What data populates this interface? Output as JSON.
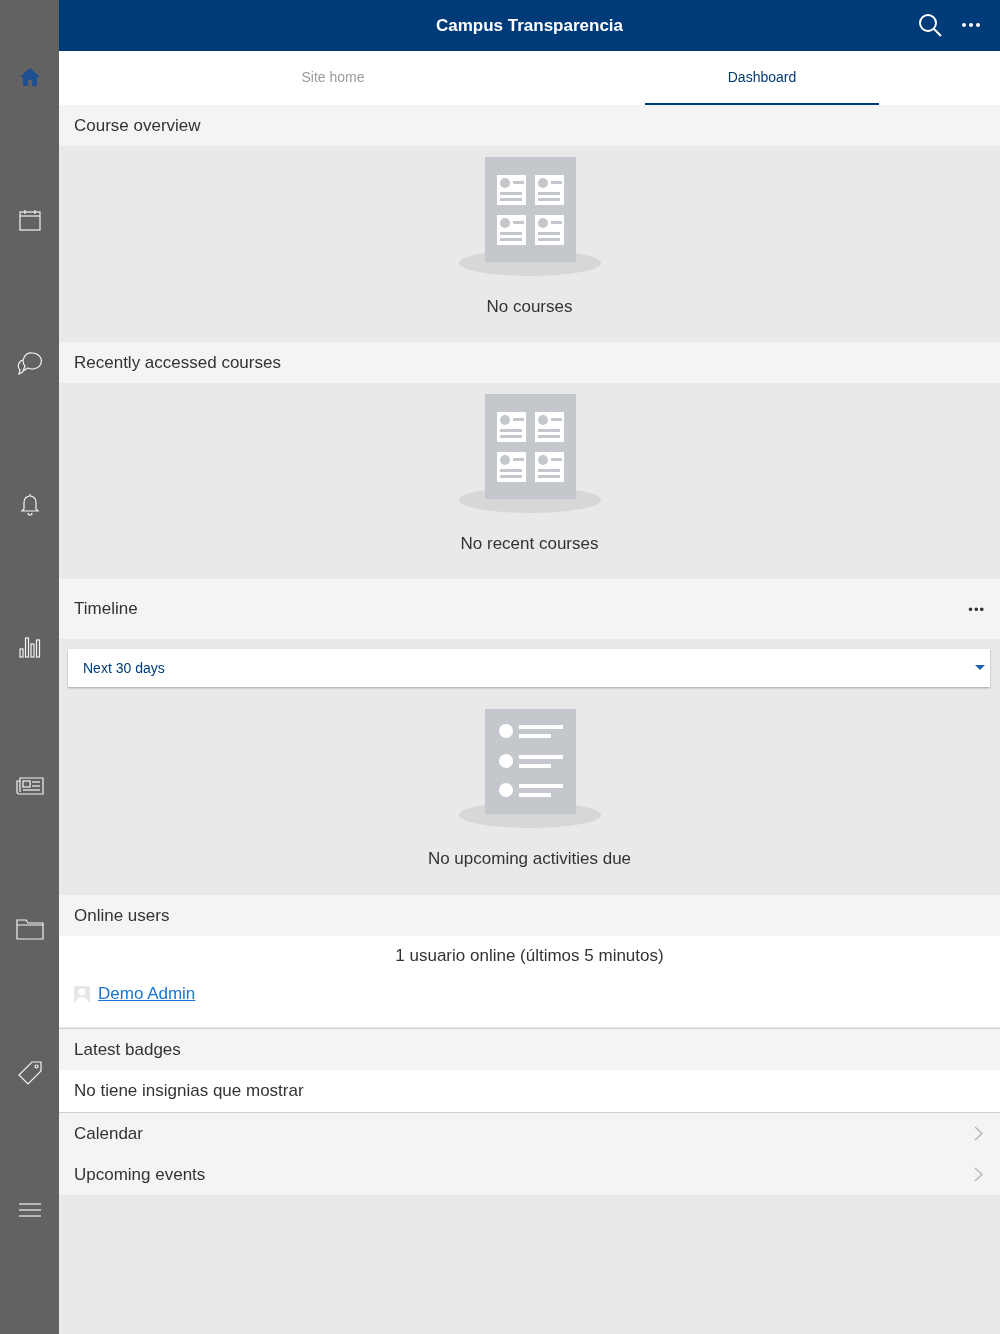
{
  "header": {
    "title": "Campus Transparencia"
  },
  "sidebar": {
    "items": [
      {
        "kind": "home",
        "selected": true
      },
      {
        "kind": "calendar",
        "selected": false
      },
      {
        "kind": "chat",
        "selected": false
      },
      {
        "kind": "bell",
        "selected": false
      },
      {
        "kind": "chart",
        "selected": false
      },
      {
        "kind": "news",
        "selected": false
      },
      {
        "kind": "folder",
        "selected": false
      },
      {
        "kind": "tag",
        "selected": false
      },
      {
        "kind": "menu",
        "selected": false
      }
    ]
  },
  "tabs": [
    {
      "label": "Site home",
      "selected": false
    },
    {
      "label": "Dashboard",
      "selected": true
    }
  ],
  "blocks": [
    {
      "kind": "empty",
      "title": "Course overview",
      "message": "No courses"
    },
    {
      "kind": "empty",
      "title": "Recently accessed courses",
      "message": "No recent courses"
    },
    {
      "kind": "timeline",
      "title": "Timeline",
      "menu": "•••",
      "filter": "Next 30 days",
      "message": "No upcoming activities due"
    },
    {
      "kind": "users",
      "title": "Online users",
      "summary": "1 usuario online (últimos 5 minutos)",
      "users": [
        "Demo Admin"
      ]
    },
    {
      "kind": "text",
      "title": "Latest badges",
      "message": "No tiene insignias que mostrar"
    },
    {
      "kind": "link",
      "title": "Calendar"
    },
    {
      "kind": "link",
      "title": "Upcoming events"
    }
  ]
}
